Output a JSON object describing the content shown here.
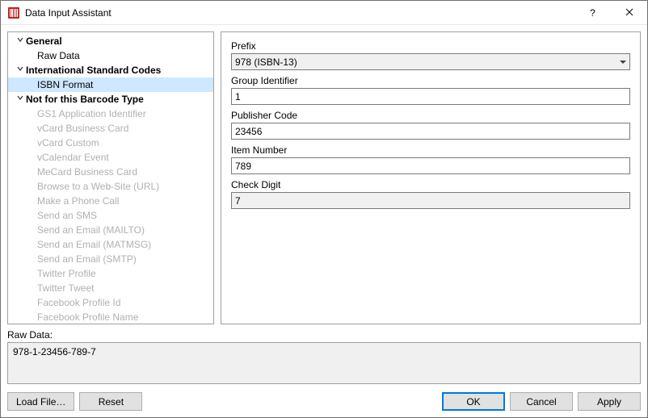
{
  "window": {
    "title": "Data Input Assistant"
  },
  "tree": {
    "groups": [
      {
        "label": "General",
        "expanded": true,
        "items": [
          {
            "label": "Raw Data",
            "disabled": false,
            "selected": false
          }
        ]
      },
      {
        "label": "International Standard Codes",
        "expanded": true,
        "items": [
          {
            "label": "ISBN Format",
            "disabled": false,
            "selected": true
          }
        ]
      },
      {
        "label": "Not for this Barcode Type",
        "expanded": true,
        "items": [
          {
            "label": "GS1 Application Identifier",
            "disabled": true
          },
          {
            "label": "vCard Business Card",
            "disabled": true
          },
          {
            "label": "vCard Custom",
            "disabled": true
          },
          {
            "label": "vCalendar Event",
            "disabled": true
          },
          {
            "label": "MeCard Business Card",
            "disabled": true
          },
          {
            "label": "Browse to a Web-Site (URL)",
            "disabled": true
          },
          {
            "label": "Make a Phone Call",
            "disabled": true
          },
          {
            "label": "Send an SMS",
            "disabled": true
          },
          {
            "label": "Send an Email (MAILTO)",
            "disabled": true
          },
          {
            "label": "Send an Email (MATMSG)",
            "disabled": true
          },
          {
            "label": "Send an Email (SMTP)",
            "disabled": true
          },
          {
            "label": "Twitter Profile",
            "disabled": true
          },
          {
            "label": "Twitter Tweet",
            "disabled": true
          },
          {
            "label": "Facebook Profile Id",
            "disabled": true
          },
          {
            "label": "Facebook Profile Name",
            "disabled": true
          }
        ]
      }
    ]
  },
  "form": {
    "prefix_label": "Prefix",
    "prefix_value": "978 (ISBN-13)",
    "group_label": "Group Identifier",
    "group_value": "1",
    "publisher_label": "Publisher Code",
    "publisher_value": "23456",
    "item_label": "Item Number",
    "item_value": "789",
    "check_label": "Check Digit",
    "check_value": "7"
  },
  "rawdata": {
    "label": "Raw Data:",
    "value": "978-1-23456-789-7"
  },
  "buttons": {
    "load_file": "Load File…",
    "reset": "Reset",
    "ok": "OK",
    "cancel": "Cancel",
    "apply": "Apply"
  }
}
